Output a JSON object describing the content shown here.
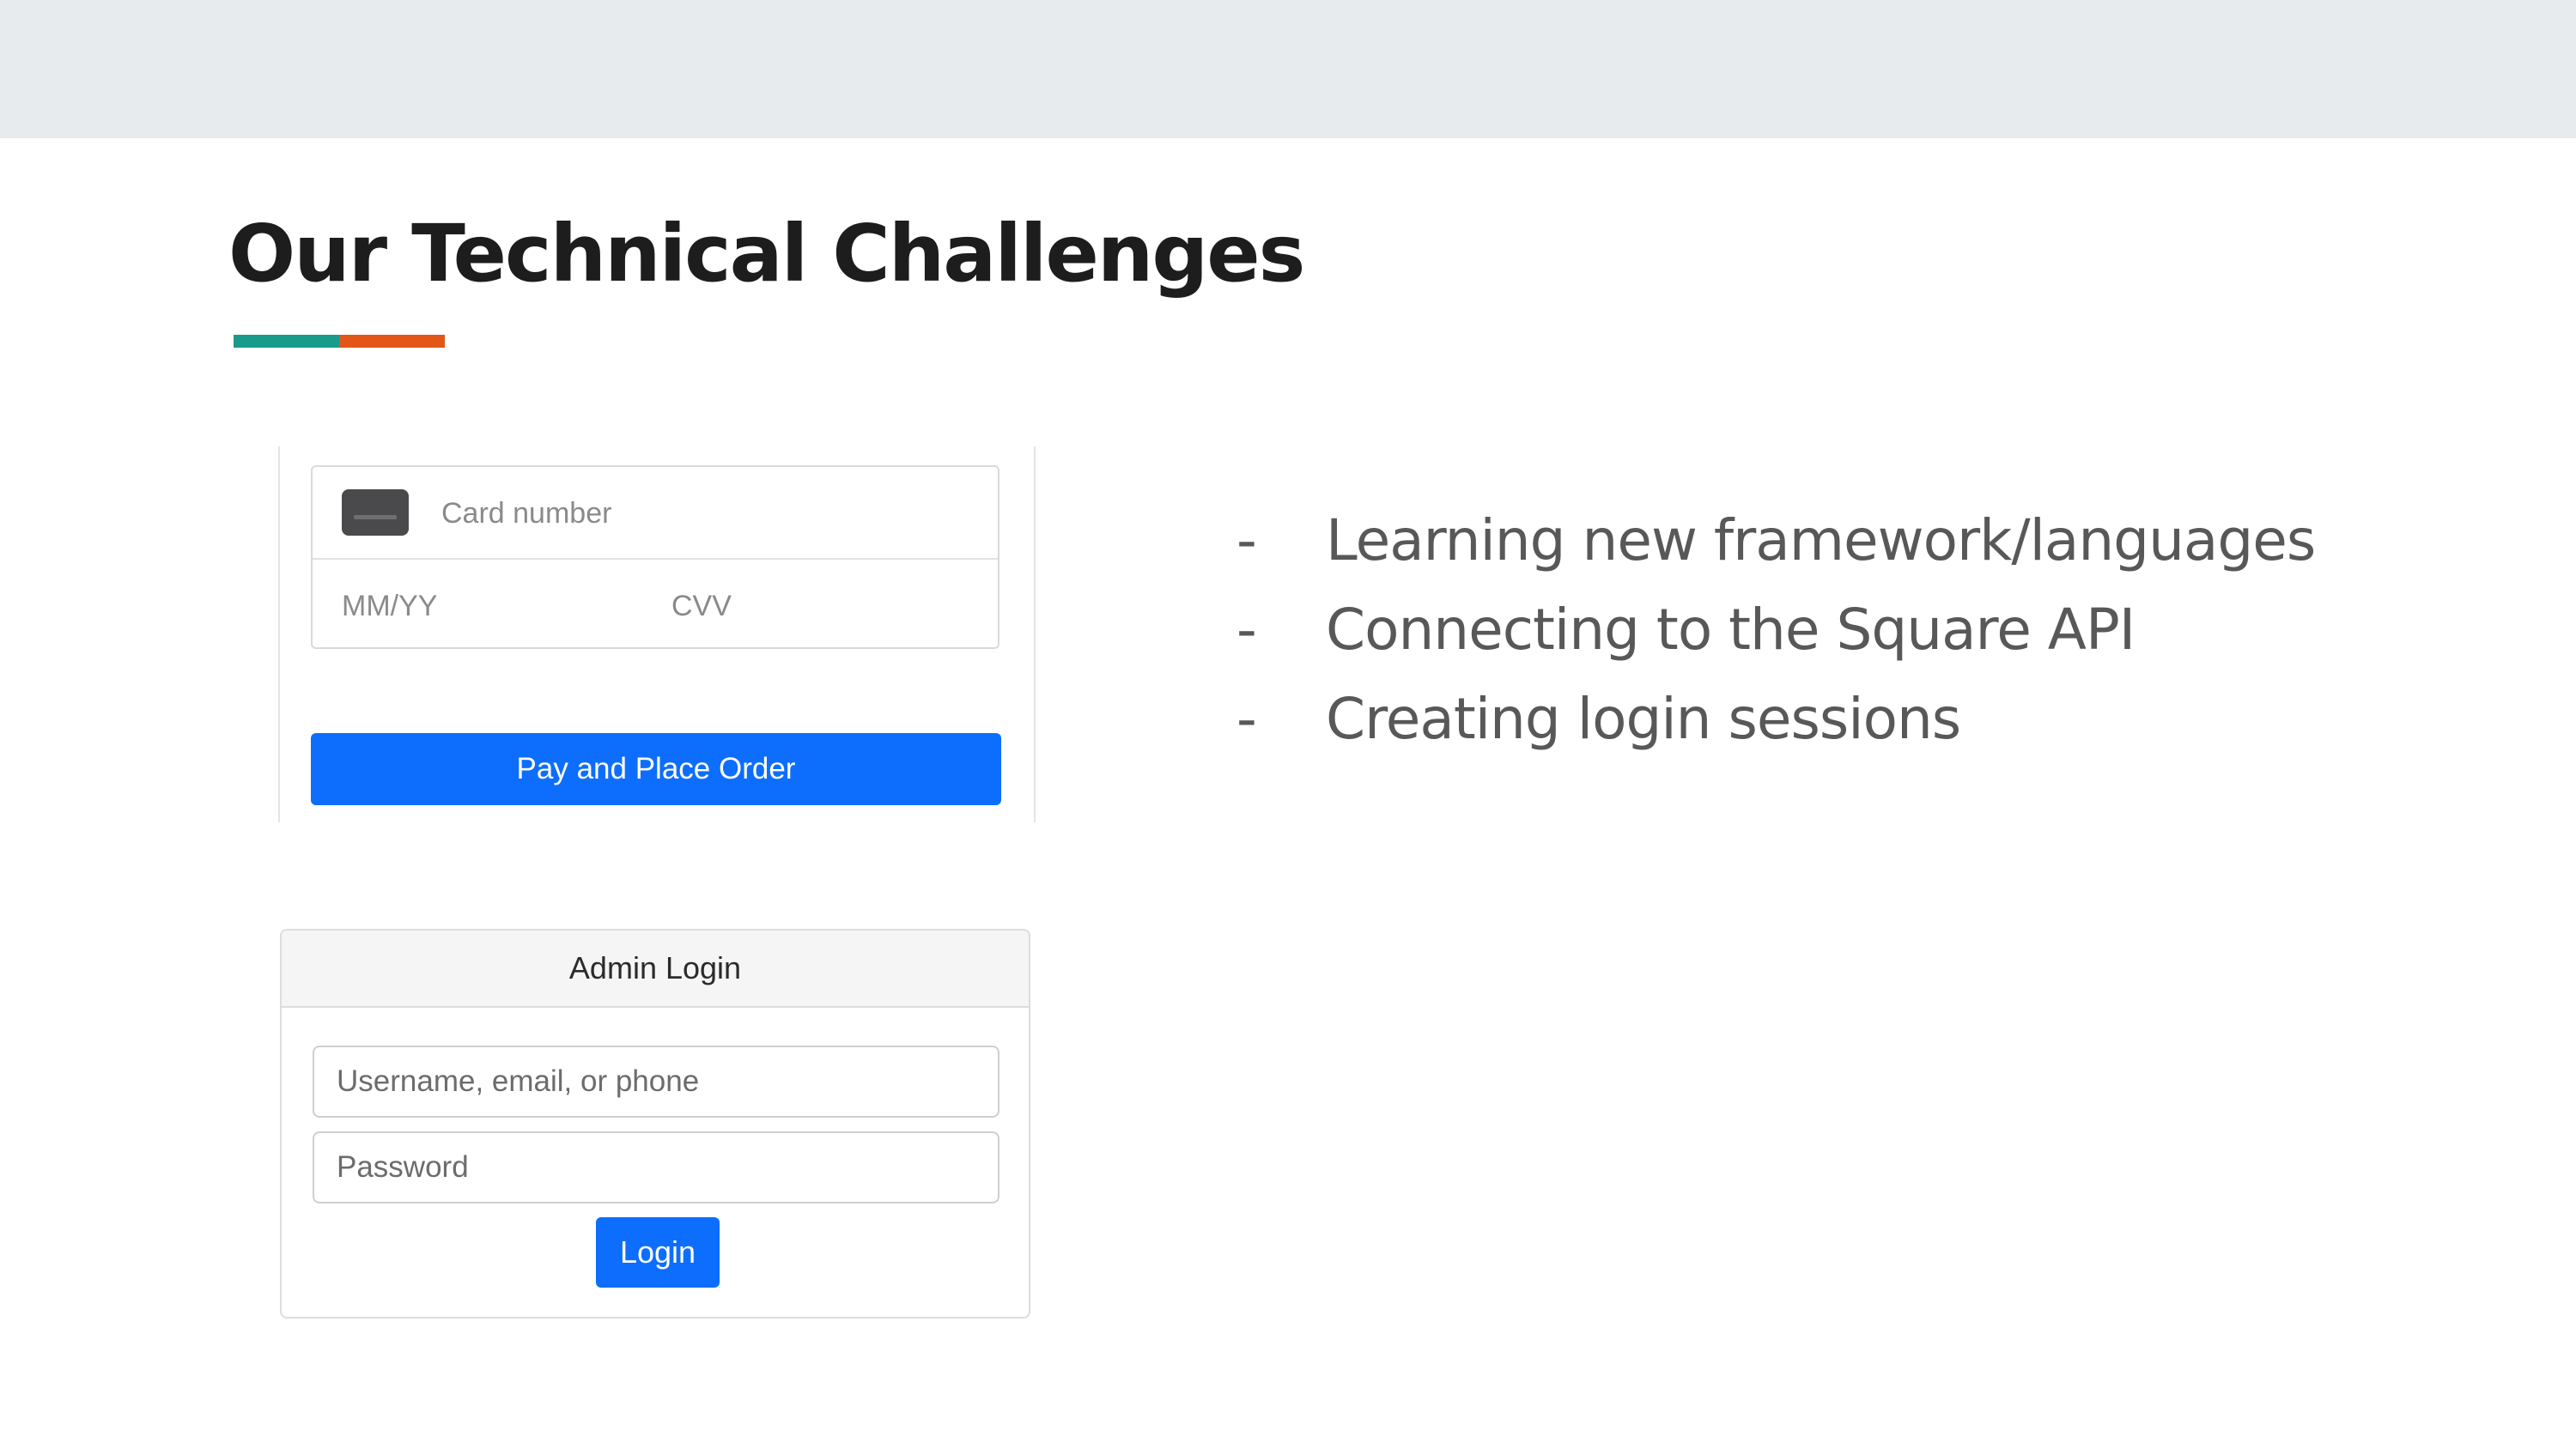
{
  "slide": {
    "title": "Our Technical Challenges",
    "accent_colors": [
      "#1a9a8a",
      "#e2561a"
    ]
  },
  "payment_form": {
    "card_icon": "credit-card-icon",
    "card_number_placeholder": "Card number",
    "expiry_placeholder": "MM/YY",
    "cvv_placeholder": "CVV",
    "pay_button_label": "Pay and Place Order",
    "button_color": "#0d6efd"
  },
  "admin_login": {
    "header": "Admin Login",
    "username_placeholder": "Username, email, or phone",
    "password_placeholder": "Password",
    "login_button_label": "Login"
  },
  "bullets": [
    {
      "marker": "-",
      "text": "Learning new framework/languages"
    },
    {
      "marker": "-",
      "text": "Connecting to the Square API"
    },
    {
      "marker": "-",
      "text": "Creating login sessions"
    }
  ]
}
